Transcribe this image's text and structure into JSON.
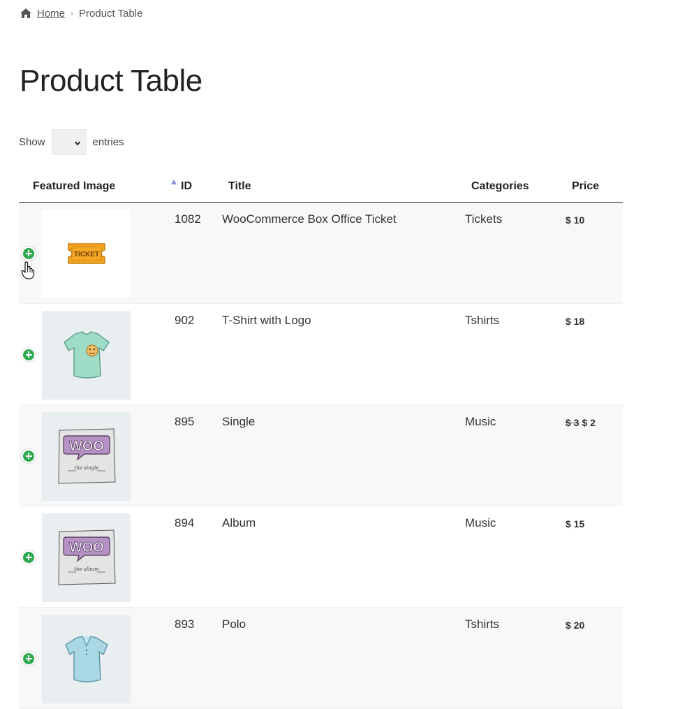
{
  "breadcrumb": {
    "home": "Home",
    "separator": "›",
    "current": "Product Table"
  },
  "page_title": "Product Table",
  "length_control": {
    "show": "Show",
    "entries": "entries",
    "selected": ""
  },
  "table": {
    "headers": {
      "image": "Featured Image",
      "id": "ID",
      "title": "Title",
      "categories": "Categories",
      "price": "Price"
    },
    "sorted_column": "image",
    "rows": [
      {
        "image": "ticket-image",
        "image_label": "TICKET",
        "id": "1082",
        "title": "WooCommerce Box Office Ticket",
        "category": "Tickets",
        "price_old": "",
        "price": "$ 10"
      },
      {
        "image": "tshirt-logo-image",
        "image_label": "",
        "id": "902",
        "title": "T-Shirt with Logo",
        "category": "Tshirts",
        "price_old": "",
        "price": "$ 18"
      },
      {
        "image": "woo-single-image",
        "image_label": "WOO",
        "image_caption": "the single",
        "id": "895",
        "title": "Single",
        "category": "Music",
        "price_old": "$ 3",
        "price": "$ 2"
      },
      {
        "image": "woo-album-image",
        "image_label": "WOO",
        "image_caption": "the album",
        "id": "894",
        "title": "Album",
        "category": "Music",
        "price_old": "",
        "price": "$ 15"
      },
      {
        "image": "polo-image",
        "image_label": "",
        "id": "893",
        "title": "Polo",
        "category": "Tshirts",
        "price_old": "",
        "price": "$ 20"
      }
    ]
  },
  "colors": {
    "expand": "#2fa84f",
    "sort_arrow": "#8a8fd6",
    "ticket": "#f5a623",
    "tshirt": "#9fdcc6",
    "polo": "#a9d8e4",
    "woo_purple": "#9b7ab0"
  }
}
